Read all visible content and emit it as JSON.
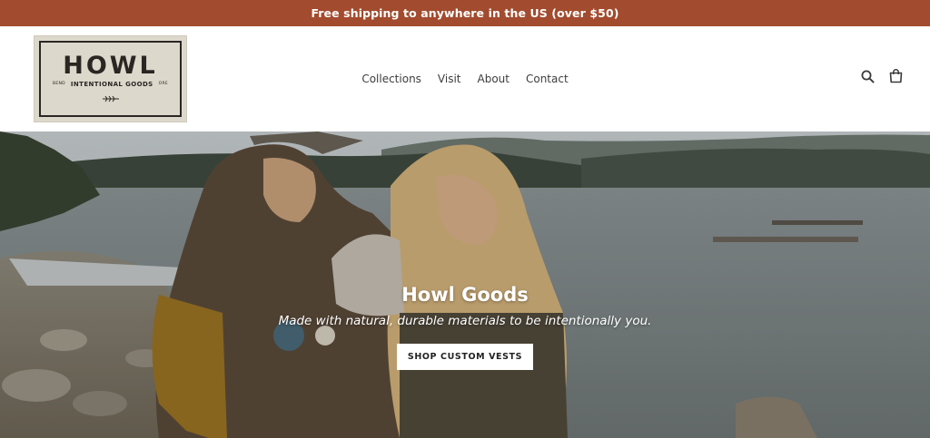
{
  "announcement": {
    "text": "Free shipping to anywhere in the US (over $50)"
  },
  "logo": {
    "wordmark": "HOWL",
    "tagline": "INTENTIONAL GOODS",
    "left_small": "BEND",
    "right_small": "ORE"
  },
  "nav": {
    "items": [
      {
        "label": "Collections"
      },
      {
        "label": "Visit"
      },
      {
        "label": "About"
      },
      {
        "label": "Contact"
      }
    ]
  },
  "header_icons": {
    "search": "search-icon",
    "cart": "cart-icon"
  },
  "hero": {
    "title": "Howl Goods",
    "subtitle": "Made with natural, durable materials to be intentionally you.",
    "button_label": "SHOP CUSTOM VESTS"
  },
  "colors": {
    "announcement_bg": "#a24b2e",
    "logo_bg": "#ddd8cc",
    "text": "#3d3d3d"
  }
}
